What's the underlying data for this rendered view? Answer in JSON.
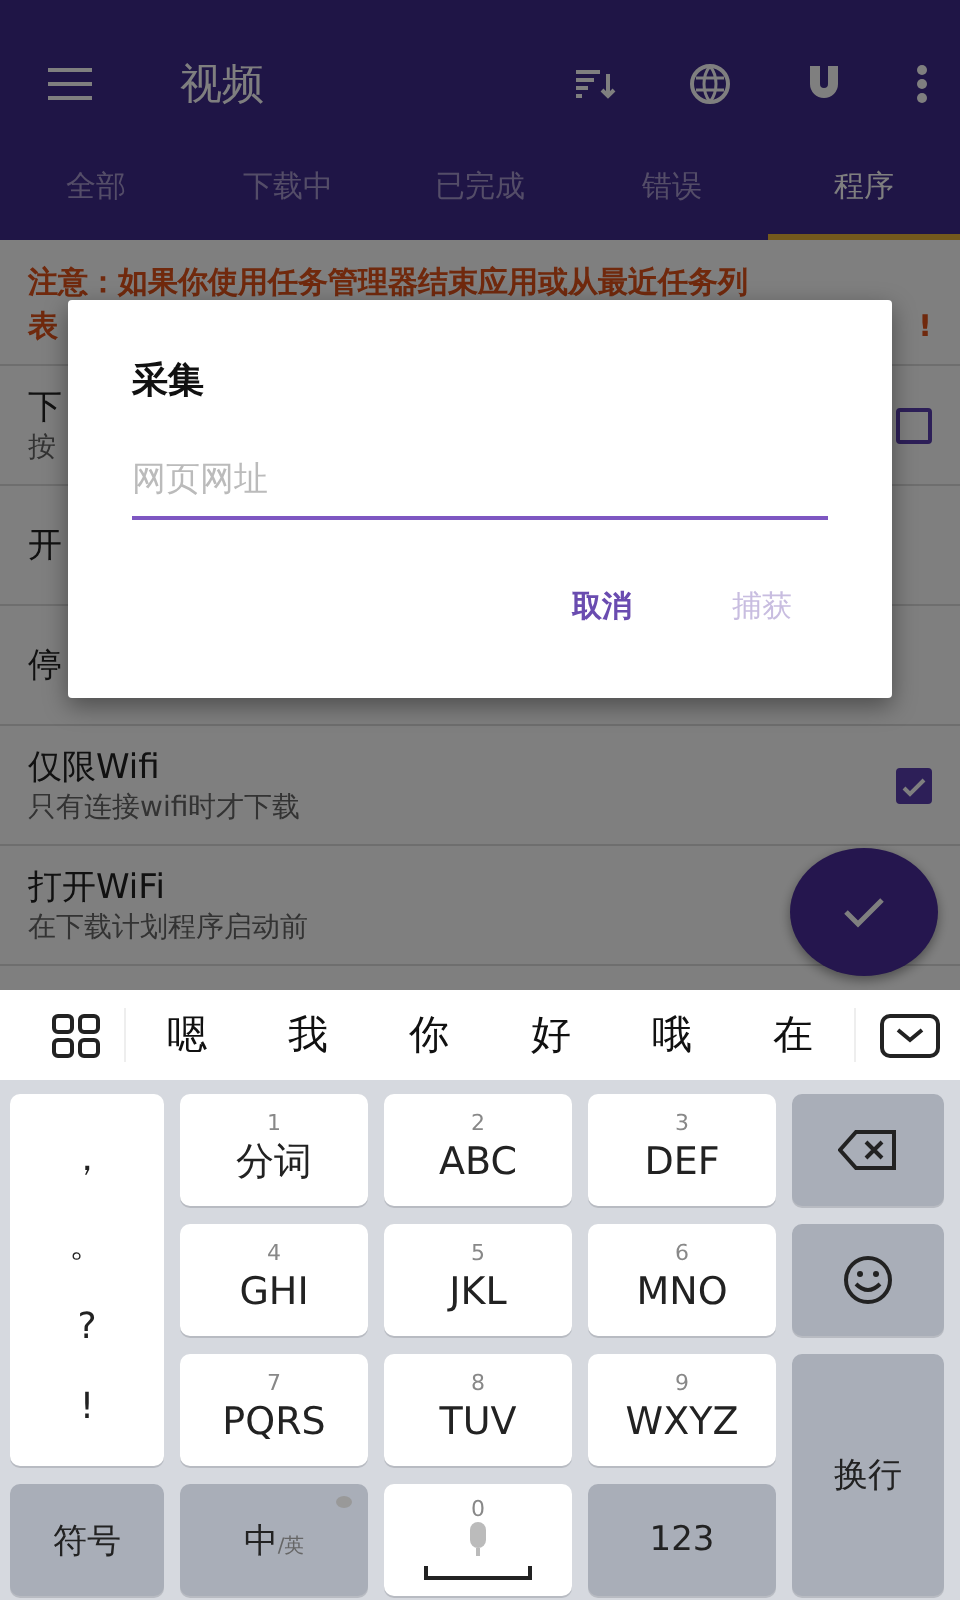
{
  "app_bar": {
    "title": "视频"
  },
  "tabs": [
    {
      "label": "全部",
      "selected": false
    },
    {
      "label": "下载中",
      "selected": false
    },
    {
      "label": "已完成",
      "selected": false
    },
    {
      "label": "错误",
      "selected": false
    },
    {
      "label": "程序",
      "selected": true
    }
  ],
  "notice": {
    "line_1": "注意：如果你使用任务管理器结束应用或从最近任务列",
    "line_2_start": "表",
    "line_2_end": "!"
  },
  "settings": [
    {
      "kind": "checkbox",
      "title": "下",
      "subtitle": "按",
      "checked": false
    },
    {
      "kind": "text",
      "title": "开"
    },
    {
      "kind": "text",
      "title": "停"
    },
    {
      "kind": "checkbox",
      "title": "仅限Wifi",
      "subtitle": "只有连接wifi时才下载",
      "checked": true
    },
    {
      "kind": "text",
      "title": "打开WiFi",
      "subtitle": "在下载计划程序启动前"
    }
  ],
  "dialog": {
    "title": "采集",
    "input": {
      "placeholder": "网页网址"
    },
    "buttons": [
      {
        "label": "取消",
        "disabled": false
      },
      {
        "label": "捕获",
        "disabled": true
      }
    ]
  },
  "keyboard": {
    "candidates": [
      "嗯",
      "我",
      "你",
      "好",
      "哦",
      "在"
    ],
    "keys": [
      {
        "kind": "punct",
        "labels": [
          "，",
          "。",
          "?",
          "!"
        ]
      },
      {
        "kind": "letter",
        "number": "1",
        "label": "分词"
      },
      {
        "kind": "letter",
        "number": "2",
        "label": "ABC"
      },
      {
        "kind": "letter",
        "number": "3",
        "label": "DEF"
      },
      {
        "kind": "backspace"
      },
      {
        "kind": "letter",
        "number": "4",
        "label": "GHI"
      },
      {
        "kind": "letter",
        "number": "5",
        "label": "JKL"
      },
      {
        "kind": "letter",
        "number": "6",
        "label": "MNO"
      },
      {
        "kind": "emoji"
      },
      {
        "kind": "letter",
        "number": "7",
        "label": "PQRS"
      },
      {
        "kind": "letter",
        "number": "8",
        "label": "TUV"
      },
      {
        "kind": "letter",
        "number": "9",
        "label": "WXYZ"
      },
      {
        "kind": "enter",
        "label": "换行"
      },
      {
        "kind": "function",
        "label": "符号"
      },
      {
        "kind": "lang",
        "label": "中",
        "sub": "/英"
      },
      {
        "kind": "space",
        "number": "0"
      },
      {
        "kind": "function",
        "label": "123"
      }
    ]
  }
}
